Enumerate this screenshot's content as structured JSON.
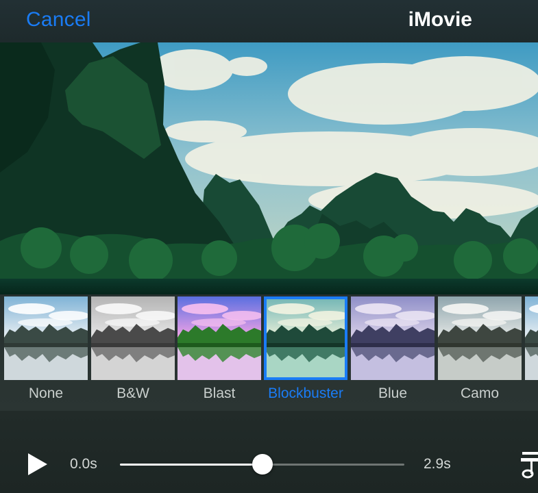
{
  "navbar": {
    "cancel_label": "Cancel",
    "title": "iMovie"
  },
  "filters": {
    "selected": "Blockbuster",
    "items": [
      {
        "label": "None",
        "tint": "none"
      },
      {
        "label": "B&W",
        "tint": "bw"
      },
      {
        "label": "Blast",
        "tint": "blast"
      },
      {
        "label": "Blockbuster",
        "tint": "blockbuster"
      },
      {
        "label": "Blue",
        "tint": "blue"
      },
      {
        "label": "Camo",
        "tint": "camo"
      },
      {
        "label": "",
        "tint": "none"
      }
    ]
  },
  "playback": {
    "current_time": "0.0s",
    "total_time": "2.9s",
    "progress": 0.5
  },
  "colors": {
    "accent": "#1a7cf5",
    "label": "#c9cfcd"
  },
  "icons": {
    "play": "play-icon",
    "audio": "audio-adjust-icon"
  }
}
